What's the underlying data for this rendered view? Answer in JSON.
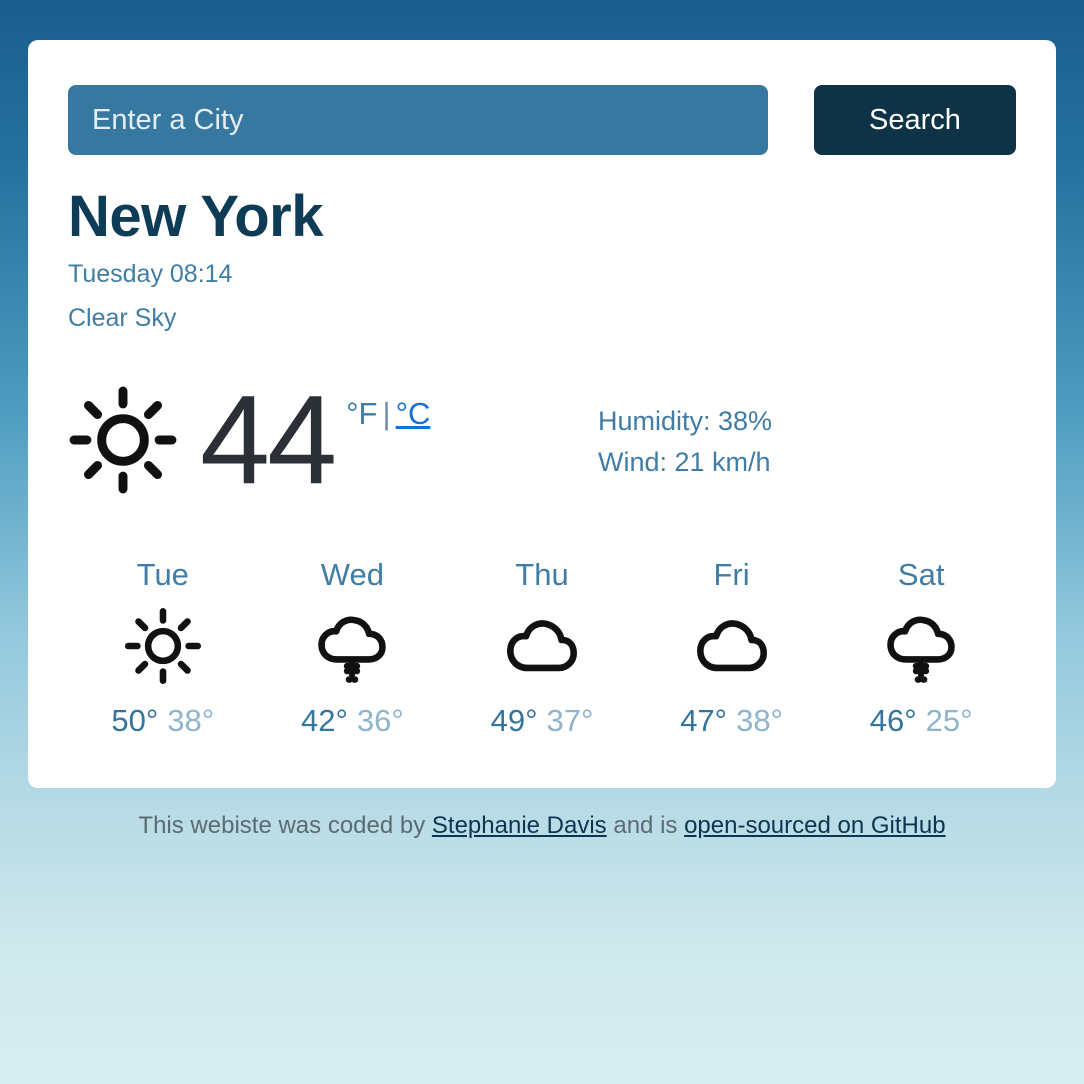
{
  "search": {
    "placeholder": "Enter a City",
    "value": "",
    "button_label": "Search"
  },
  "current": {
    "city": "New York",
    "datetime": "Tuesday 08:14",
    "description": "Clear Sky",
    "icon": "sun-icon",
    "temperature": "44",
    "unit_active": "°F",
    "unit_separator": "|",
    "unit_link": "°C",
    "humidity": "Humidity: 38%",
    "wind": "Wind: 21 km/h"
  },
  "forecast": [
    {
      "day": "Tue",
      "icon": "sun-icon",
      "max": "50°",
      "min": "38°"
    },
    {
      "day": "Wed",
      "icon": "cloud-snow-icon",
      "max": "42°",
      "min": "36°"
    },
    {
      "day": "Thu",
      "icon": "cloud-icon",
      "max": "49°",
      "min": "37°"
    },
    {
      "day": "Fri",
      "icon": "cloud-icon",
      "max": "47°",
      "min": "38°"
    },
    {
      "day": "Sat",
      "icon": "cloud-snow-icon",
      "max": "46°",
      "min": "25°"
    }
  ],
  "footer": {
    "text_before": "This webiste was coded by ",
    "author_link": "Stephanie Davis",
    "text_middle": " and is ",
    "source_link": "open-sourced on GitHub"
  },
  "colors": {
    "bg_top": "#1a5d8e",
    "bg_bottom": "#d9eef0",
    "card": "#ffffff",
    "input": "#36789f",
    "button": "#0e3347",
    "heading": "#0e3b55",
    "accent_text": "#3f7da5",
    "link": "#1a6fd4",
    "temp_max": "#35749c",
    "temp_min": "#8fb4cb",
    "footer_text": "#5b6b72",
    "footer_link": "#0d3550"
  }
}
